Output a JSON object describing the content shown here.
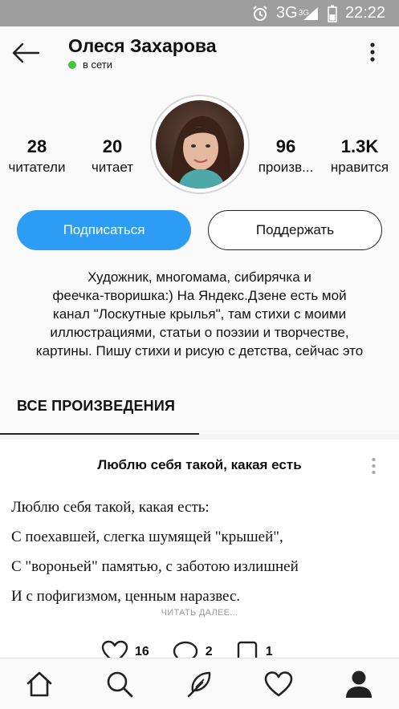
{
  "status_bar": {
    "network": "3G",
    "network_sup": "3G",
    "time": "22:22"
  },
  "profile": {
    "name": "Олеся Захарова",
    "online_status": "в сети",
    "online_color": "#3ec63e"
  },
  "stats": [
    {
      "value": "28",
      "label": "читатели"
    },
    {
      "value": "20",
      "label": "читает"
    },
    {
      "value": "96",
      "label": "произв..."
    },
    {
      "value": "1.3K",
      "label": "нравится"
    }
  ],
  "buttons": {
    "subscribe": "Подписаться",
    "support": "Поддержать",
    "subscribe_color": "#2d9cf4"
  },
  "bio": [
    "Художник, многомама, сибирячка и",
    "феечка-творишка:) На Яндекс.Дзене есть мой",
    "канал \"Лоскутные крылья\", там стихи с моими",
    "иллюстрациями, статьи о поэзии и творчестве,",
    "картины. Пишу стихи и рисую с детства, сейчас это"
  ],
  "section_title": "ВСЕ ПРОИЗВЕДЕНИЯ",
  "post": {
    "title": "Люблю себя такой, какая есть",
    "lines": [
      "Люблю себя такой, какая есть:",
      "С поехавшей, слегка шумящей \"крышей\",",
      "С \"вороньей\" памятью, с заботою излишней",
      "И с пофигизмом, ценным наразвес."
    ],
    "read_more": "ЧИТАТЬ ДАЛЕЕ...",
    "likes": "16",
    "comments": "2",
    "reposts": "1"
  },
  "bottom_nav": [
    "home-icon",
    "search-icon",
    "feather-icon",
    "heart-icon",
    "profile-icon"
  ]
}
